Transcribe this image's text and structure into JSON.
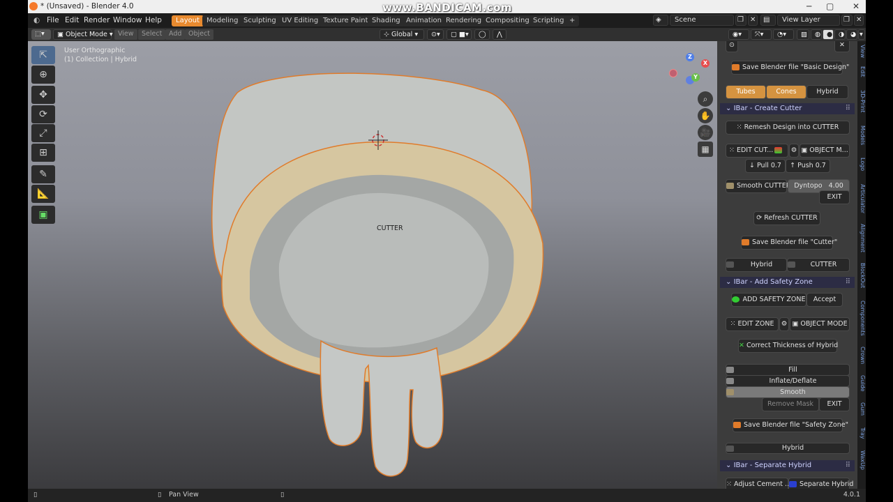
{
  "window": {
    "title": "* (Unsaved) - Blender 4.0",
    "watermark": "www.BANDICAM.com"
  },
  "menus": [
    "File",
    "Edit",
    "Render",
    "Window",
    "Help"
  ],
  "workspaces": [
    "Layout",
    "Modeling",
    "Sculpting",
    "UV Editing",
    "Texture Paint",
    "Shading",
    "Animation",
    "Rendering",
    "Compositing",
    "Scripting",
    "+"
  ],
  "scene": "Scene",
  "view_layer": "View Layer",
  "header": {
    "mode": "Object Mode",
    "view": "View",
    "select": "Select",
    "add": "Add",
    "object": "Object",
    "orientation": "Global"
  },
  "viewport": {
    "view_name": "User Orthographic",
    "collection": "(1) Collection | Hybrid",
    "object_label": "CUTTER"
  },
  "panel": {
    "save_basic": "Save Blender file \"Basic Design\"",
    "tubes": "Tubes",
    "cones": "Cones",
    "hybrid": "Hybrid",
    "sec_create_cutter": "IBar - Create Cutter",
    "remesh": "Remesh Design into CUTTER",
    "edit_cut": "EDIT CUT...",
    "object_m": "OBJECT M...",
    "pull": "Pull 0.7",
    "push": "Push 0.7",
    "smooth_cutter": "Smooth CUTTER",
    "dyntopo": "Dyntopo",
    "dyntopo_val": "4.00",
    "exit": "EXIT",
    "refresh_cutter": "Refresh CUTTER",
    "save_cutter": "Save Blender file \"Cutter\"",
    "hybrid2": "Hybrid",
    "cutter2": "CUTTER",
    "sec_safety": "IBar - Add Safety Zone",
    "add_safety": "ADD SAFETY ZONE",
    "accept": "Accept",
    "edit_zone": "EDIT ZONE",
    "object_mode": "OBJECT MODE",
    "correct_thickness": "Correct Thickness of Hybrid",
    "fill": "Fill",
    "inflate": "Inflate/Deflate",
    "smooth": "Smooth",
    "remove_mask": "Remove Mask",
    "exit2": "EXIT",
    "save_safety": "Save Blender file \"Safety Zone\"",
    "hybrid3": "Hybrid",
    "sec_separate": "IBar - Separate Hybrid",
    "adjust_cement": "Adjust Cement ...",
    "separate_hybrid": "Separate Hybrid"
  },
  "side_tabs": [
    "View",
    "Edit",
    "3D-Print",
    "Models",
    "Logo",
    "Articulator",
    "Alignment",
    "BlockOut",
    "Components",
    "Crown",
    "Guide",
    "Gum",
    "Tray",
    "WaxUp"
  ],
  "status": {
    "hint": "Pan View",
    "version": "4.0.1"
  }
}
